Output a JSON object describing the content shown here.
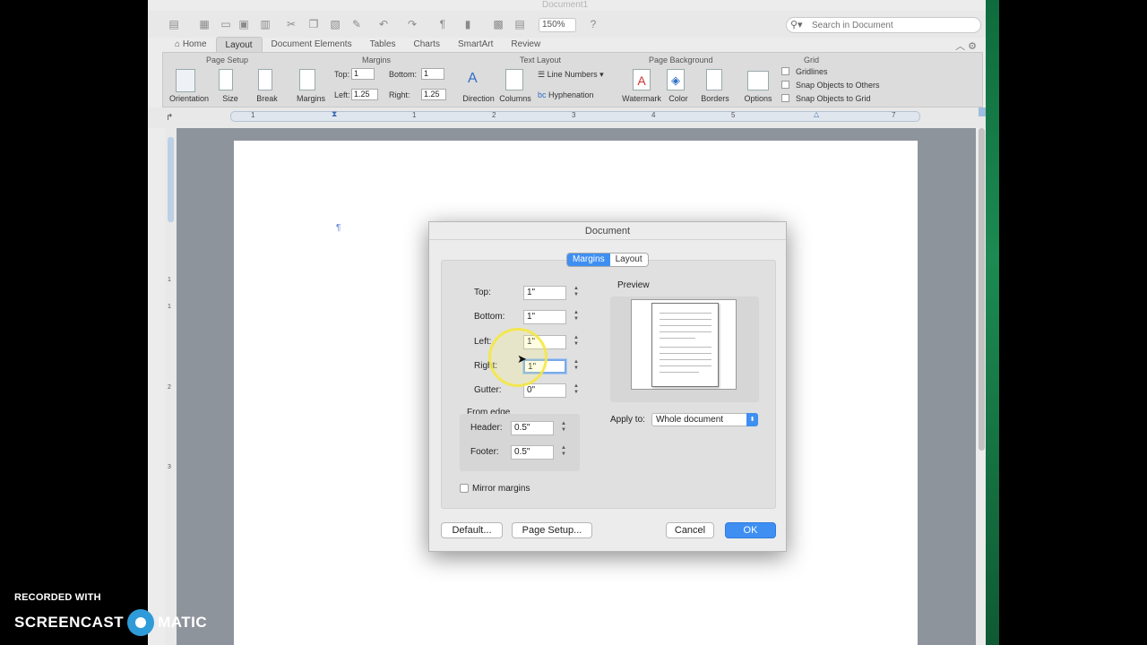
{
  "window": {
    "title": "Document1",
    "zoom": "150%"
  },
  "search": {
    "placeholder": "Search in Document"
  },
  "tabs": [
    {
      "label": "Home"
    },
    {
      "label": "Layout"
    },
    {
      "label": "Document Elements"
    },
    {
      "label": "Tables"
    },
    {
      "label": "Charts"
    },
    {
      "label": "SmartArt"
    },
    {
      "label": "Review"
    }
  ],
  "ribbon": {
    "groups": {
      "page_setup": "Page Setup",
      "margins": "Margins",
      "text_layout": "Text Layout",
      "page_background": "Page Background",
      "grid": "Grid"
    },
    "buttons": {
      "orientation": "Orientation",
      "size": "Size",
      "break": "Break",
      "margins": "Margins",
      "direction": "Direction",
      "columns": "Columns",
      "watermark": "Watermark",
      "color": "Color",
      "borders": "Borders",
      "options": "Options"
    },
    "margin_fields": {
      "top_label": "Top:",
      "top_value": "1",
      "bottom_label": "Bottom:",
      "bottom_value": "1",
      "left_label": "Left:",
      "left_value": "1.25",
      "right_label": "Right:",
      "right_value": "1.25"
    },
    "text_layout": {
      "line_numbers": "Line Numbers",
      "hyphenation": "Hyphenation"
    },
    "grid": {
      "gridlines": "Gridlines",
      "snap_others": "Snap Objects to Others",
      "snap_grid": "Snap Objects to Grid"
    }
  },
  "ruler_numbers": [
    "1",
    "1",
    "2",
    "3",
    "4",
    "5",
    "7"
  ],
  "vruler_numbers": [
    "1",
    "1",
    "2",
    "3"
  ],
  "document": {
    "pilcrow": "¶"
  },
  "dialog": {
    "title": "Document",
    "seg_margins": "Margins",
    "seg_layout": "Layout",
    "fields": {
      "top_label": "Top:",
      "top_value": "1\"",
      "bottom_label": "Bottom:",
      "bottom_value": "1\"",
      "left_label": "Left:",
      "left_value": "1\"",
      "right_label": "Right:",
      "right_value": "1\"",
      "gutter_label": "Gutter:",
      "gutter_value": "0\""
    },
    "from_edge": "From edge",
    "header_label": "Header:",
    "header_value": "0.5\"",
    "footer_label": "Footer:",
    "footer_value": "0.5\"",
    "mirror_margins": "Mirror margins",
    "preview": "Preview",
    "apply_to_label": "Apply to:",
    "apply_to_value": "Whole document",
    "default_btn": "Default...",
    "page_setup_btn": "Page Setup...",
    "cancel_btn": "Cancel",
    "ok_btn": "OK"
  },
  "watermark": {
    "line1": "RECORDED WITH",
    "line2a": "SCREENCAST",
    "line2b": "MATIC"
  }
}
